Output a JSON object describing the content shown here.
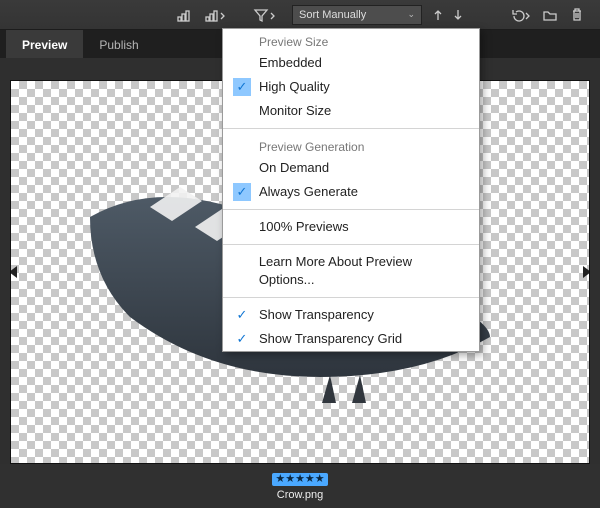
{
  "toolbar": {
    "sort_value": "Sort Manually"
  },
  "tabs": {
    "preview": "Preview",
    "publish": "Publish"
  },
  "menu": {
    "groups": {
      "preview_size": {
        "label": "Preview Size",
        "embedded": "Embedded",
        "high_quality": "High Quality",
        "monitor_size": "Monitor Size"
      },
      "preview_generation": {
        "label": "Preview Generation",
        "on_demand": "On Demand",
        "always_generate": "Always Generate"
      }
    },
    "items": {
      "pct_previews": "100% Previews",
      "learn_more": "Learn More About Preview Options...",
      "show_transparency": "Show Transparency",
      "show_transparency_grid": "Show Transparency Grid"
    }
  },
  "footer": {
    "filename": "Crow.png",
    "stars": "★★★★★"
  }
}
